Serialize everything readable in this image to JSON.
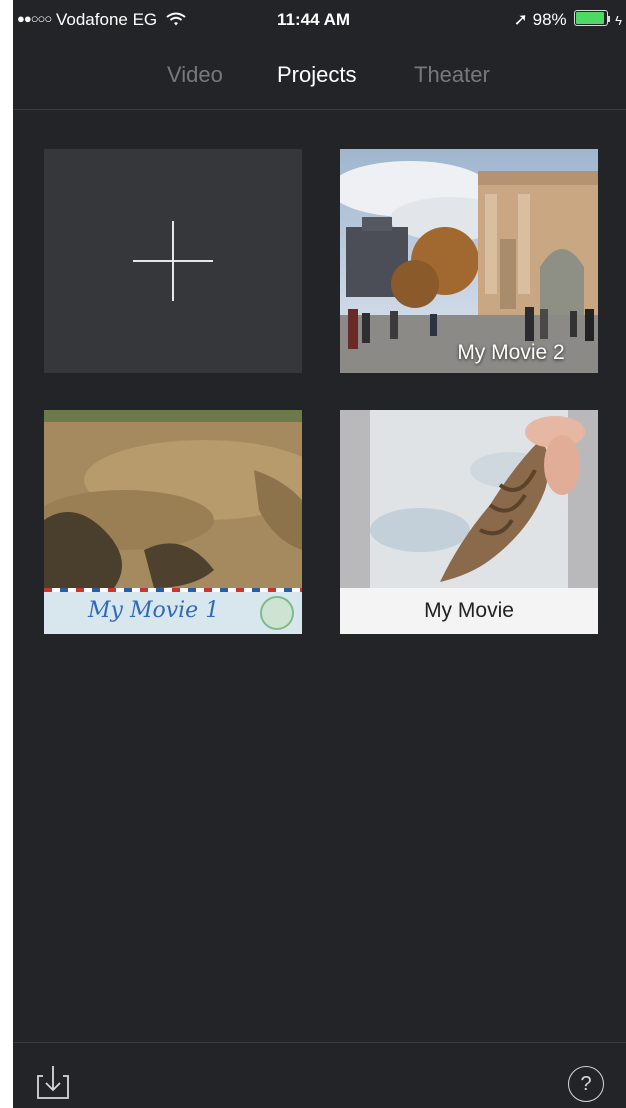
{
  "status_bar": {
    "signal_dots": "●●○○○",
    "carrier": "Vodafone EG",
    "wifi_icon": "wifi-icon",
    "time": "11:44 AM",
    "location_icon": "➚",
    "battery_percent": "98%",
    "battery_level": 0.98,
    "charging_icon": "ϟ"
  },
  "tabs": [
    {
      "label": "Video",
      "active": false
    },
    {
      "label": "Projects",
      "active": true
    },
    {
      "label": "Theater",
      "active": false
    }
  ],
  "projects": {
    "new_project_icon": "plus-icon",
    "items": [
      {
        "title": "My Movie 2"
      },
      {
        "title": "My Movie 1"
      },
      {
        "title": "My Movie"
      }
    ]
  },
  "toolbar": {
    "import_icon": "import-icon",
    "help_label": "?"
  },
  "colors": {
    "background": "#232428",
    "tab_active": "#ffffff",
    "tab_inactive": "#77787d",
    "battery": "#4cd964"
  }
}
